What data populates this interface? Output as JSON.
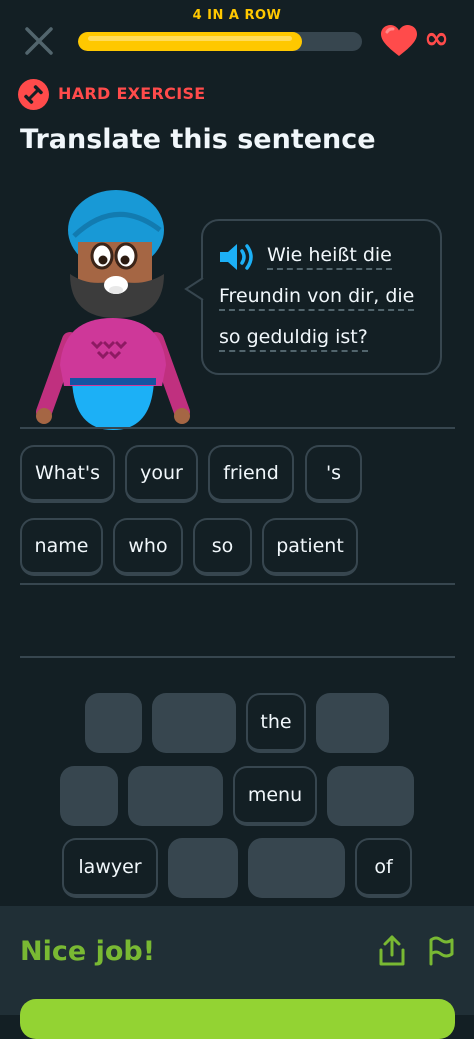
{
  "header": {
    "streak_label": "4 IN A ROW",
    "progress_fraction": 0.79,
    "infinity_label": "∞",
    "colors": {
      "progress": "#ffc800",
      "heart": "#ff4b4b"
    }
  },
  "exercise": {
    "badge_label": "HARD EXERCISE",
    "title": "Translate this sentence",
    "prompt_lines": [
      "Wie heißt die",
      "Freundin von dir, die",
      "so geduldig ist?"
    ]
  },
  "answer": {
    "words": [
      "What's",
      "your",
      "friend",
      "'s",
      "name",
      "who",
      "so",
      "patient"
    ]
  },
  "word_bank": {
    "words": [
      "the",
      "menu",
      "lawyer",
      "of"
    ]
  },
  "footer": {
    "message": "Nice job!",
    "colors": {
      "success": "#79b933",
      "button": "#93d333"
    }
  },
  "icons": [
    "close-icon",
    "heart-icon",
    "dumbbell-icon",
    "speaker-icon",
    "share-icon",
    "flag-icon"
  ]
}
